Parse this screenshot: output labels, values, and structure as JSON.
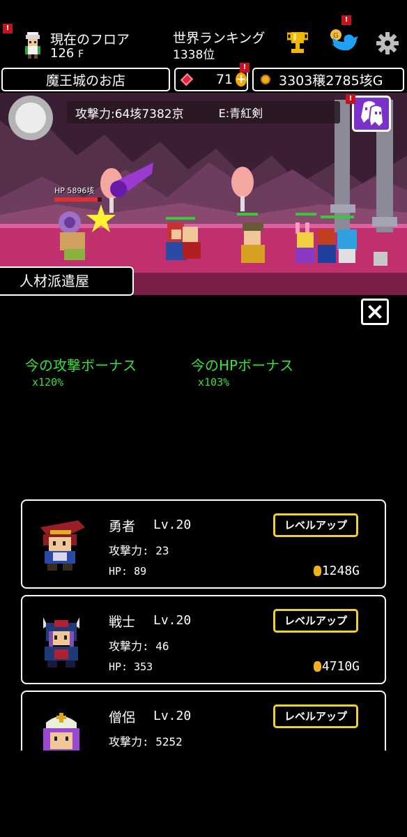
{
  "header": {
    "floor_label": "現在のフロア",
    "floor_value": "126",
    "floor_unit": "F",
    "ranking_label": "世界ランキング",
    "ranking_value": "1338位",
    "alert_mark": "!"
  },
  "hud": {
    "shop_label": "魔王城のお店",
    "gems": "71",
    "plus": "+",
    "gold": "3303穣2785垓G"
  },
  "battle": {
    "attack_power": "攻撃力:64垓7382京",
    "equipment": "E:青紅剣",
    "enemy_hp": "HP 5896垓"
  },
  "panel": {
    "title": "人材派遣屋",
    "attack_bonus_label": "今の攻撃ボーナス",
    "attack_bonus_value": "x120%",
    "hp_bonus_label": "今のHPボーナス",
    "hp_bonus_value": "x103%"
  },
  "members": [
    {
      "name": "勇者",
      "level": "Lv.20",
      "attack": "攻撃力: 23",
      "hp": "HP: 89",
      "cost": "1248G",
      "button": "レベルアップ"
    },
    {
      "name": "戦士",
      "level": "Lv.20",
      "attack": "攻撃力: 46",
      "hp": "HP: 353",
      "cost": "4710G",
      "button": "レベルアップ"
    },
    {
      "name": "僧侶",
      "level": "Lv.20",
      "attack": "攻撃力: 5252",
      "hp": "",
      "cost": "",
      "button": "レベルアップ"
    }
  ],
  "colors": {
    "bonus_green": "#36e23a",
    "button_border": "#f0d22c",
    "alert_red": "#c0141e",
    "gem_red": "#e0283a",
    "gold": "#f0b020"
  },
  "icons": [
    "avatar-icon",
    "trophy-icon",
    "twitter-bird-icon",
    "gear-icon",
    "gem-icon",
    "plus-icon",
    "coin-icon",
    "ghost-icon",
    "close-icon"
  ]
}
